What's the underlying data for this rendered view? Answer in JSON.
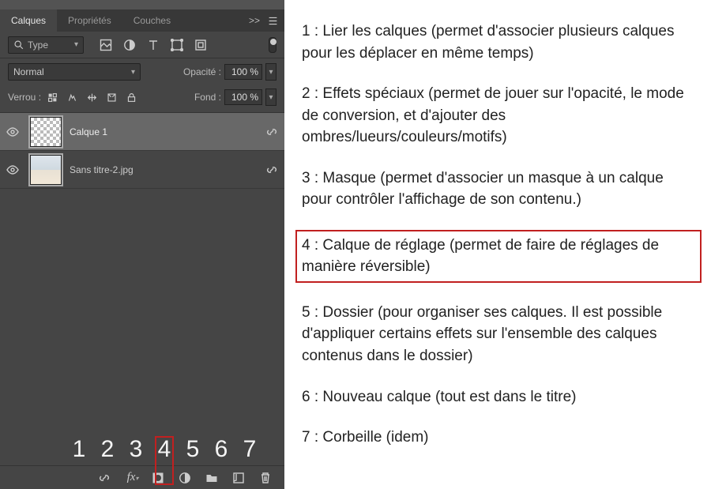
{
  "tabs": {
    "t1": "Calques",
    "t2": "Propriétés",
    "t3": "Couches",
    "expand": ">>"
  },
  "filter": {
    "type_label": "Type"
  },
  "blend": {
    "mode": "Normal",
    "opacity_label": "Opacité :",
    "opacity_value": "100 %"
  },
  "lock": {
    "label": "Verrou :",
    "fill_label": "Fond :",
    "fill_value": "100 %"
  },
  "layers": [
    {
      "name": "Calque 1"
    },
    {
      "name": "Sans titre-2.jpg"
    }
  ],
  "numbers": [
    "1",
    "2",
    "3",
    "4",
    "5",
    "6",
    "7"
  ],
  "doc": {
    "i1": "1 : Lier les calques (permet d'associer plusieurs calques pour les déplacer en même temps)",
    "i2": "2 : Effets spéciaux (permet de jouer sur l'opacité, le mode de conversion, et d'ajouter des ombres/lueurs/couleurs/motifs)",
    "i3": "3 : Masque (permet d'associer un masque à un calque pour contrôler l'affichage de son contenu.)",
    "i4": "4 : Calque de réglage (permet de faire de réglages de manière réversible)",
    "i5": "5 : Dossier (pour organiser ses calques. Il est possible d'appliquer certains effets sur l'ensemble des calques contenus dans le dossier)",
    "i6": "6 : Nouveau calque (tout est dans le titre)",
    "i7": "7 : Corbeille (idem)"
  }
}
